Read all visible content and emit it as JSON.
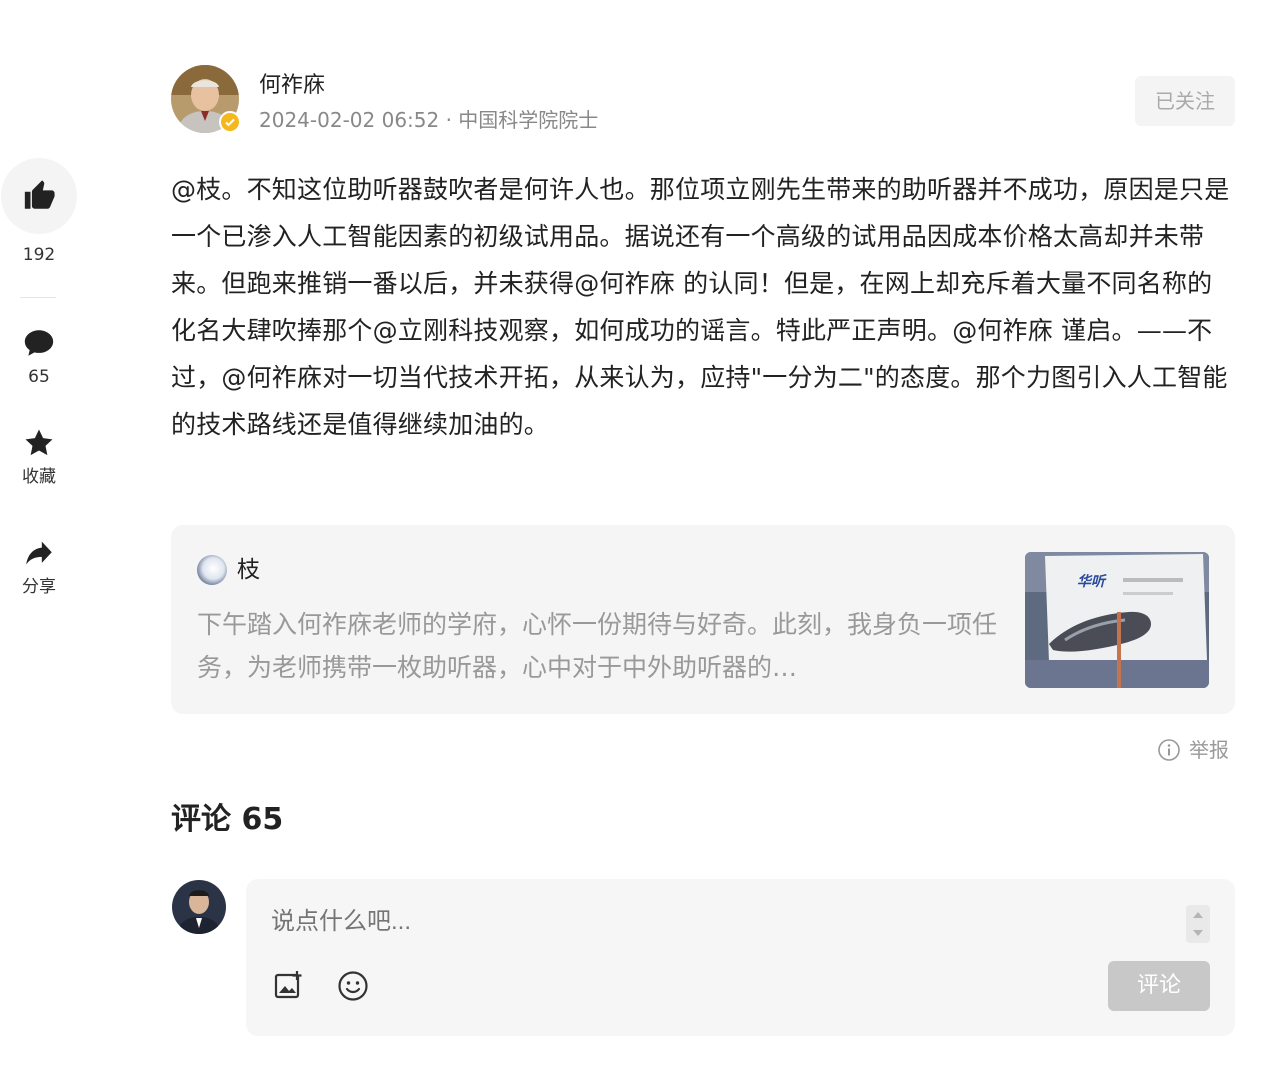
{
  "rail": {
    "like_count": "192",
    "comment_count": "65",
    "favorite_label": "收藏",
    "share_label": "分享"
  },
  "header": {
    "author_name": "何祚庥",
    "meta": "2024-02-02 06:52 · 中国科学院院士",
    "follow_label": "已关注"
  },
  "post": {
    "body": "@枝。不知这位助听器鼓吹者是何许人也。那位项立刚先生带来的助听器并不成功，原因是只是一个已渗入人工智能因素的初级试用品。据说还有一个高级的试用品因成本价格太高却并未带来。但跑来推销一番以后，并未获得@何祚庥 的认同！但是，在网上却充斥着大量不同名称的化名大肆吹捧那个@立刚科技观察，如何成功的谣言。特此严正声明。@何祚庥 谨启。——不过，@何祚庥对一切当代技术开拓，从来认为，应持\"一分为二\"的态度。那个力图引入人工智能的技术路线还是值得继续加油的。"
  },
  "quote": {
    "author": "枝",
    "text": "下午踏入何祚庥老师的学府，心怀一份期待与好奇。此刻，我身负一项任务，为老师携带一枚助听器，心中对于中外助听器的…",
    "thumb_brand": "华听"
  },
  "report_label": "举报",
  "comments": {
    "heading": "评论 65",
    "placeholder": "说点什么吧...",
    "submit_label": "评论"
  }
}
